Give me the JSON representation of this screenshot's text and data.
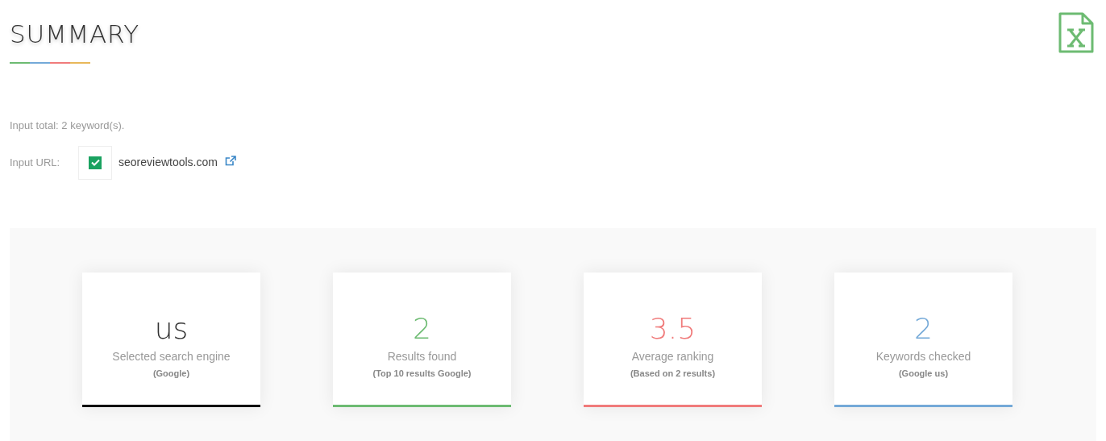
{
  "title": "SUMMARY",
  "input_total": "Input total: 2 keyword(s).",
  "input_url": {
    "label": "Input URL:",
    "checked": true,
    "url": "seoreviewtools.com"
  },
  "cards": [
    {
      "value": "us",
      "label": "Selected search engine",
      "note": "(Google)",
      "color": "#000000"
    },
    {
      "value": "2",
      "label": "Results found",
      "note": "(Top 10 results Google)",
      "color": "#6dbb72"
    },
    {
      "value": "3.5",
      "label": "Average ranking",
      "note": "(Based on 2 results)",
      "color": "#f07b7b"
    },
    {
      "value": "2",
      "label": "Keywords checked",
      "note": "(Google us)",
      "color": "#74a9d8"
    }
  ]
}
